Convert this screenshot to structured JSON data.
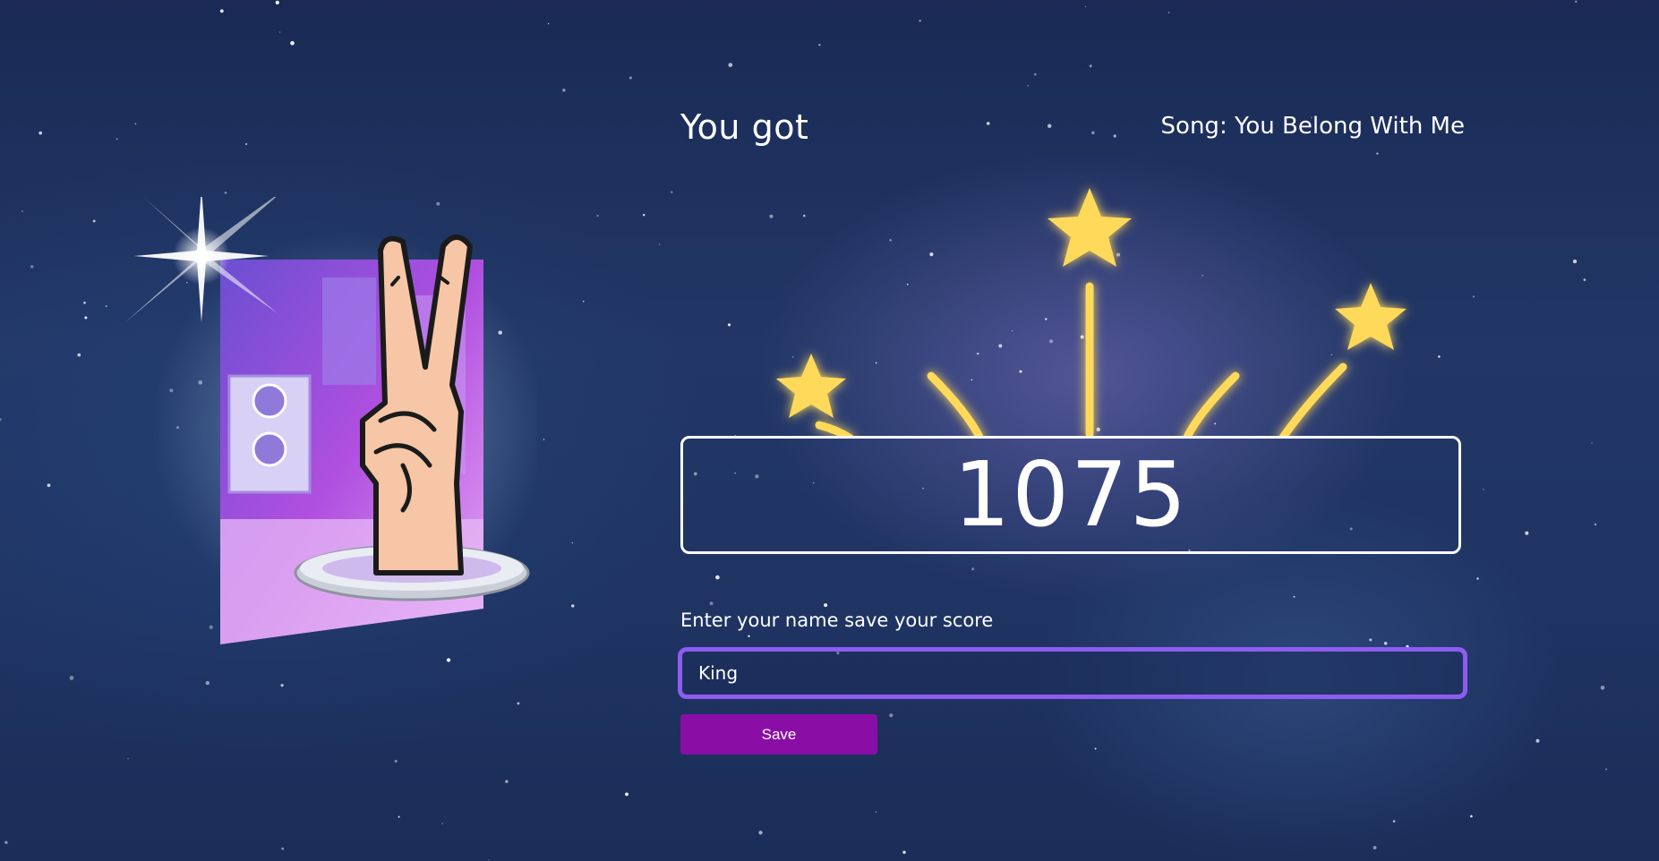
{
  "header": {
    "title": "You got",
    "song_prefix": "Song: ",
    "song_name": "You Belong With Me"
  },
  "score": {
    "value": "1075"
  },
  "form": {
    "prompt": "Enter your name save your score",
    "name_value": "King",
    "save_label": "Save"
  },
  "colors": {
    "background": "#1f3463",
    "star": "#ffd95a",
    "input_border": "#8e5cf0",
    "save_button": "#8a0ea6",
    "score_border": "#ffffff"
  },
  "icons": {
    "illustration": "peace-sign-hand-icon",
    "celebration": "star-burst-icon"
  }
}
